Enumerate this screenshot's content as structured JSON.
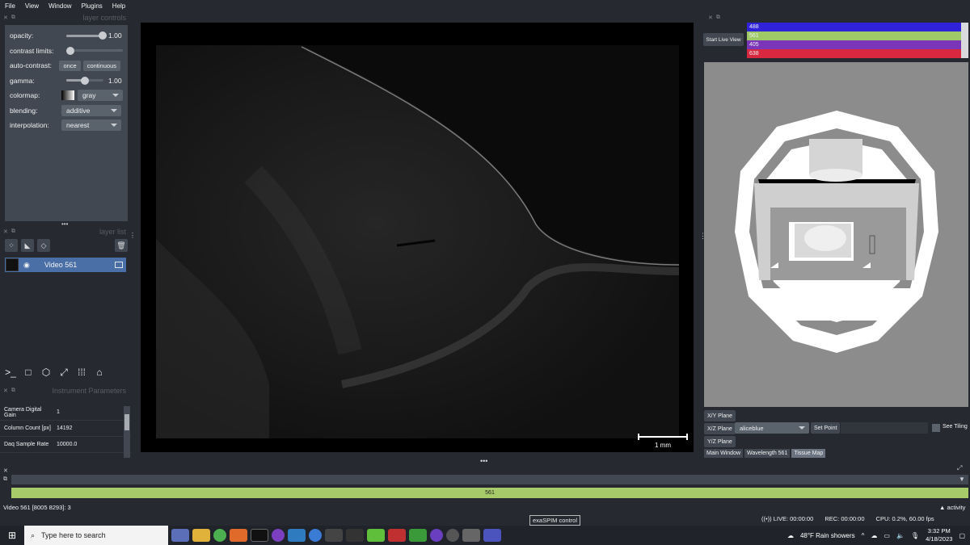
{
  "menu": [
    "File",
    "View",
    "Window",
    "Plugins",
    "Help"
  ],
  "layer_controls": {
    "title": "layer controls",
    "opacity_label": "opacity:",
    "opacity_value": "1.00",
    "opacity_level": 1.0,
    "contrast_label": "contrast limits:",
    "autocontrast_label": "auto-contrast:",
    "once_label": "once",
    "continuous_label": "continuous",
    "gamma_label": "gamma:",
    "gamma_value": "1.00",
    "gamma_level": 0.5,
    "colormap_label": "colormap:",
    "colormap_value": "gray",
    "blending_label": "blending:",
    "blending_value": "additive",
    "interpolation_label": "interpolation:",
    "interpolation_value": "nearest"
  },
  "layer_list": {
    "title": "layer list",
    "layers": [
      {
        "name": "Video 561"
      }
    ]
  },
  "instrument": {
    "title": "Instrument Parameters",
    "rows": [
      {
        "key": "Camera Digital Gain",
        "value": "1"
      },
      {
        "key": "Column Count [px]",
        "value": "14192"
      },
      {
        "key": "Daq Sample Rate",
        "value": "10000.0"
      }
    ]
  },
  "viewer": {
    "scalebar_label": "1 mm"
  },
  "right_panel": {
    "live_button": "Start Live View",
    "wavelengths": [
      {
        "label": "488",
        "color": "#2f22d9"
      },
      {
        "label": "561",
        "color": "#9fc867"
      },
      {
        "label": "405",
        "color": "#7b35b8"
      },
      {
        "label": "638",
        "color": "#d8283f"
      }
    ],
    "xy_plane": "X/Y Plane",
    "xz_plane": "X/Z Plane",
    "yz_plane": "Y/Z Plane",
    "color_value": "aliceblue",
    "set_point": "Set Point",
    "see_tiling": "See Tiling",
    "tabs": [
      "Main Window",
      "Wavelength 561",
      "Tissue Map"
    ]
  },
  "progress": {
    "label": "561",
    "fraction": 1.0
  },
  "status": {
    "text": "Video 561 [8005 8293]: 3",
    "activity": "activity",
    "tooltip": "exaSPIM control",
    "live": "LIVE: 00:00:00",
    "rec": "REC: 00:00:00",
    "cpu": "CPU: 0.2%, 60.00 fps"
  },
  "taskbar": {
    "search_placeholder": "Type here to search",
    "weather": "48°F  Rain showers",
    "time": "3:32 PM",
    "date": "4/18/2023"
  },
  "colors": {
    "accent": "#4a6ea6",
    "progress_green": "#a8cb69",
    "panel": "#414851",
    "background": "#262930"
  }
}
